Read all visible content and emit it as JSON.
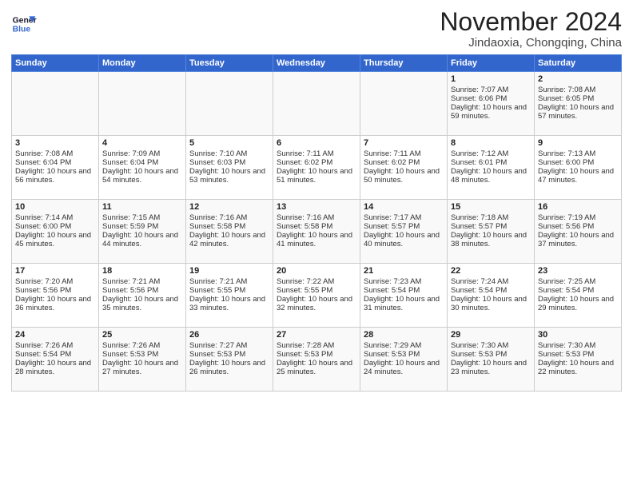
{
  "header": {
    "logo_line1": "General",
    "logo_line2": "Blue",
    "title": "November 2024",
    "location": "Jindaoxia, Chongqing, China"
  },
  "weekdays": [
    "Sunday",
    "Monday",
    "Tuesday",
    "Wednesday",
    "Thursday",
    "Friday",
    "Saturday"
  ],
  "weeks": [
    [
      {
        "day": "",
        "content": ""
      },
      {
        "day": "",
        "content": ""
      },
      {
        "day": "",
        "content": ""
      },
      {
        "day": "",
        "content": ""
      },
      {
        "day": "",
        "content": ""
      },
      {
        "day": "1",
        "content": "Sunrise: 7:07 AM\nSunset: 6:06 PM\nDaylight: 10 hours and 59 minutes."
      },
      {
        "day": "2",
        "content": "Sunrise: 7:08 AM\nSunset: 6:05 PM\nDaylight: 10 hours and 57 minutes."
      }
    ],
    [
      {
        "day": "3",
        "content": "Sunrise: 7:08 AM\nSunset: 6:04 PM\nDaylight: 10 hours and 56 minutes."
      },
      {
        "day": "4",
        "content": "Sunrise: 7:09 AM\nSunset: 6:04 PM\nDaylight: 10 hours and 54 minutes."
      },
      {
        "day": "5",
        "content": "Sunrise: 7:10 AM\nSunset: 6:03 PM\nDaylight: 10 hours and 53 minutes."
      },
      {
        "day": "6",
        "content": "Sunrise: 7:11 AM\nSunset: 6:02 PM\nDaylight: 10 hours and 51 minutes."
      },
      {
        "day": "7",
        "content": "Sunrise: 7:11 AM\nSunset: 6:02 PM\nDaylight: 10 hours and 50 minutes."
      },
      {
        "day": "8",
        "content": "Sunrise: 7:12 AM\nSunset: 6:01 PM\nDaylight: 10 hours and 48 minutes."
      },
      {
        "day": "9",
        "content": "Sunrise: 7:13 AM\nSunset: 6:00 PM\nDaylight: 10 hours and 47 minutes."
      }
    ],
    [
      {
        "day": "10",
        "content": "Sunrise: 7:14 AM\nSunset: 6:00 PM\nDaylight: 10 hours and 45 minutes."
      },
      {
        "day": "11",
        "content": "Sunrise: 7:15 AM\nSunset: 5:59 PM\nDaylight: 10 hours and 44 minutes."
      },
      {
        "day": "12",
        "content": "Sunrise: 7:16 AM\nSunset: 5:58 PM\nDaylight: 10 hours and 42 minutes."
      },
      {
        "day": "13",
        "content": "Sunrise: 7:16 AM\nSunset: 5:58 PM\nDaylight: 10 hours and 41 minutes."
      },
      {
        "day": "14",
        "content": "Sunrise: 7:17 AM\nSunset: 5:57 PM\nDaylight: 10 hours and 40 minutes."
      },
      {
        "day": "15",
        "content": "Sunrise: 7:18 AM\nSunset: 5:57 PM\nDaylight: 10 hours and 38 minutes."
      },
      {
        "day": "16",
        "content": "Sunrise: 7:19 AM\nSunset: 5:56 PM\nDaylight: 10 hours and 37 minutes."
      }
    ],
    [
      {
        "day": "17",
        "content": "Sunrise: 7:20 AM\nSunset: 5:56 PM\nDaylight: 10 hours and 36 minutes."
      },
      {
        "day": "18",
        "content": "Sunrise: 7:21 AM\nSunset: 5:56 PM\nDaylight: 10 hours and 35 minutes."
      },
      {
        "day": "19",
        "content": "Sunrise: 7:21 AM\nSunset: 5:55 PM\nDaylight: 10 hours and 33 minutes."
      },
      {
        "day": "20",
        "content": "Sunrise: 7:22 AM\nSunset: 5:55 PM\nDaylight: 10 hours and 32 minutes."
      },
      {
        "day": "21",
        "content": "Sunrise: 7:23 AM\nSunset: 5:54 PM\nDaylight: 10 hours and 31 minutes."
      },
      {
        "day": "22",
        "content": "Sunrise: 7:24 AM\nSunset: 5:54 PM\nDaylight: 10 hours and 30 minutes."
      },
      {
        "day": "23",
        "content": "Sunrise: 7:25 AM\nSunset: 5:54 PM\nDaylight: 10 hours and 29 minutes."
      }
    ],
    [
      {
        "day": "24",
        "content": "Sunrise: 7:26 AM\nSunset: 5:54 PM\nDaylight: 10 hours and 28 minutes."
      },
      {
        "day": "25",
        "content": "Sunrise: 7:26 AM\nSunset: 5:53 PM\nDaylight: 10 hours and 27 minutes."
      },
      {
        "day": "26",
        "content": "Sunrise: 7:27 AM\nSunset: 5:53 PM\nDaylight: 10 hours and 26 minutes."
      },
      {
        "day": "27",
        "content": "Sunrise: 7:28 AM\nSunset: 5:53 PM\nDaylight: 10 hours and 25 minutes."
      },
      {
        "day": "28",
        "content": "Sunrise: 7:29 AM\nSunset: 5:53 PM\nDaylight: 10 hours and 24 minutes."
      },
      {
        "day": "29",
        "content": "Sunrise: 7:30 AM\nSunset: 5:53 PM\nDaylight: 10 hours and 23 minutes."
      },
      {
        "day": "30",
        "content": "Sunrise: 7:30 AM\nSunset: 5:53 PM\nDaylight: 10 hours and 22 minutes."
      }
    ]
  ]
}
